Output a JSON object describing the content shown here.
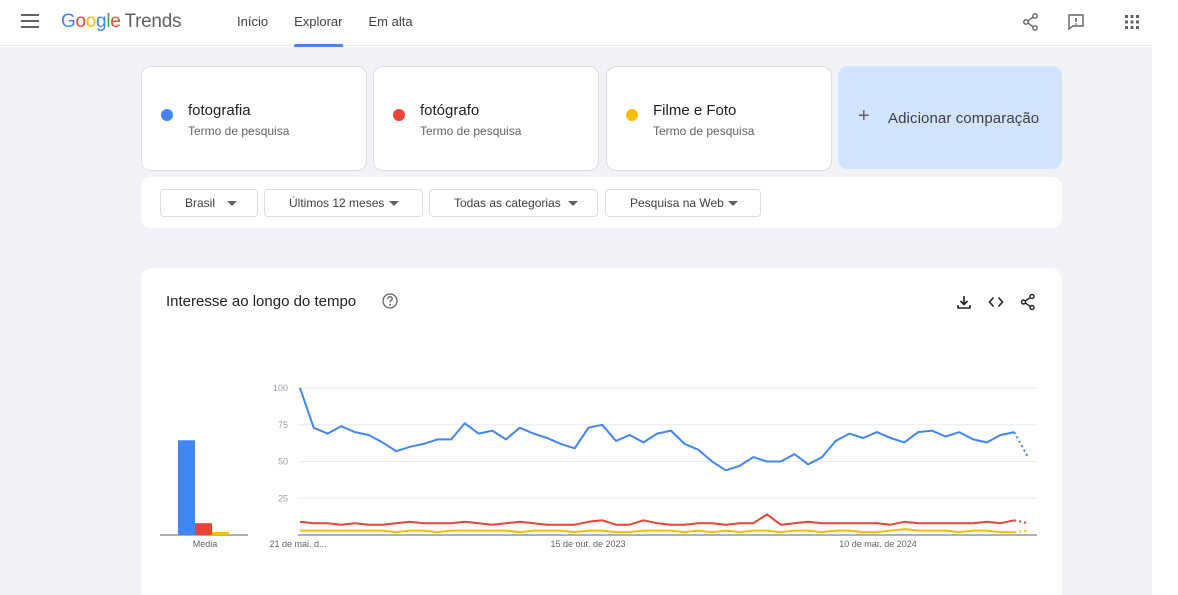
{
  "header": {
    "logo_google": [
      "G",
      "o",
      "o",
      "g",
      "l",
      "e"
    ],
    "logo_trends": "Trends",
    "tabs": [
      {
        "label": "Início",
        "active": false
      },
      {
        "label": "Explorar",
        "active": true
      },
      {
        "label": "Em alta",
        "active": false
      }
    ],
    "icons": [
      "menu-icon",
      "share-icon",
      "feedback-icon",
      "apps-grid-icon"
    ]
  },
  "terms": [
    {
      "name": "fotografia",
      "subtitle": "Termo de pesquisa",
      "color": "#4285f4"
    },
    {
      "name": "fotógrafo",
      "subtitle": "Termo de pesquisa",
      "color": "#ea4335"
    },
    {
      "name": "Filme e Foto",
      "subtitle": "Termo de pesquisa",
      "color": "#fbbc04"
    }
  ],
  "add_comparison": {
    "label": "Adicionar comparação"
  },
  "filters": [
    {
      "label": "Brasil"
    },
    {
      "label": "Últimos 12 meses"
    },
    {
      "label": "Todas as categorias"
    },
    {
      "label": "Pesquisa na Web"
    }
  ],
  "chart_card": {
    "title": "Interesse ao longo do tempo"
  },
  "chart_data": [
    {
      "type": "bar",
      "categories": [
        "Média"
      ],
      "series": [
        {
          "name": "fotografia",
          "values": [
            64
          ],
          "color": "#4285f4"
        },
        {
          "name": "fotógrafo",
          "values": [
            8
          ],
          "color": "#ea4335"
        },
        {
          "name": "Filme e Foto",
          "values": [
            2
          ],
          "color": "#fbbc04"
        }
      ],
      "xlabel": "Média",
      "ylim": [
        0,
        100
      ]
    },
    {
      "type": "line",
      "x_tick_labels": [
        "21 de mai. d...",
        "15 de out. de 2023",
        "10 de mar. de 2024"
      ],
      "y_ticks": [
        25,
        50,
        75,
        100
      ],
      "ylim": [
        0,
        100
      ],
      "grid": true,
      "partial_last_point": true,
      "series": [
        {
          "name": "fotografia",
          "color": "#4285f4",
          "values": [
            100,
            73,
            69,
            74,
            70,
            68,
            63,
            57,
            60,
            62,
            65,
            65,
            76,
            69,
            71,
            65,
            73,
            69,
            66,
            62,
            59,
            73,
            75,
            64,
            68,
            63,
            69,
            71,
            62,
            58,
            50,
            44,
            47,
            53,
            50,
            50,
            55,
            48,
            53,
            64,
            69,
            66,
            70,
            66,
            63,
            70,
            71,
            67,
            70,
            65,
            63,
            68,
            70,
            53
          ]
        },
        {
          "name": "fotógrafo",
          "color": "#ea4335",
          "values": [
            9,
            8,
            8,
            7,
            8,
            7,
            7,
            8,
            9,
            8,
            8,
            8,
            9,
            8,
            7,
            8,
            9,
            8,
            7,
            7,
            7,
            9,
            10,
            7,
            7,
            10,
            8,
            7,
            7,
            8,
            8,
            7,
            8,
            8,
            14,
            7,
            8,
            9,
            8,
            8,
            8,
            8,
            8,
            7,
            9,
            8,
            8,
            8,
            8,
            8,
            9,
            8,
            10,
            8
          ]
        },
        {
          "name": "Filme e Foto",
          "color": "#fbbc04",
          "values": [
            3,
            3,
            3,
            3,
            3,
            3,
            3,
            2,
            3,
            3,
            2,
            3,
            3,
            3,
            3,
            3,
            2,
            3,
            3,
            3,
            2,
            3,
            3,
            2,
            2,
            3,
            3,
            3,
            2,
            3,
            2,
            3,
            2,
            3,
            3,
            2,
            3,
            3,
            2,
            3,
            3,
            2,
            2,
            3,
            4,
            3,
            3,
            3,
            2,
            3,
            3,
            2,
            2,
            3
          ]
        }
      ]
    }
  ]
}
